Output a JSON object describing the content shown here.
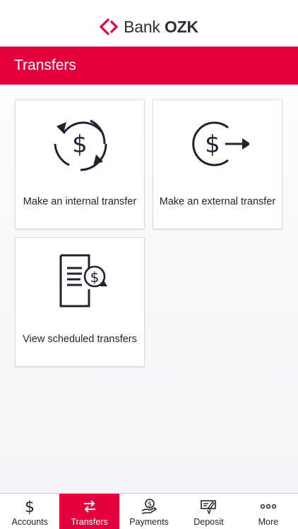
{
  "brand": {
    "name_light": "Bank",
    "name_bold": "OZK",
    "accent": "#e3003c"
  },
  "header": {
    "title": "Transfers"
  },
  "tiles": [
    {
      "label": "Make an internal transfer",
      "icon": "dollar-cycle-icon"
    },
    {
      "label": "Make an external transfer",
      "icon": "dollar-arrow-out-icon"
    },
    {
      "label": "View scheduled transfers",
      "icon": "scheduled-document-icon"
    }
  ],
  "tabs": [
    {
      "label": "Accounts",
      "icon": "dollar-icon",
      "active": false
    },
    {
      "label": "Transfers",
      "icon": "transfer-arrows-icon",
      "active": true
    },
    {
      "label": "Payments",
      "icon": "hand-dollar-icon",
      "active": false
    },
    {
      "label": "Deposit",
      "icon": "check-deposit-icon",
      "active": false
    },
    {
      "label": "More",
      "icon": "more-dots-icon",
      "active": false
    }
  ]
}
